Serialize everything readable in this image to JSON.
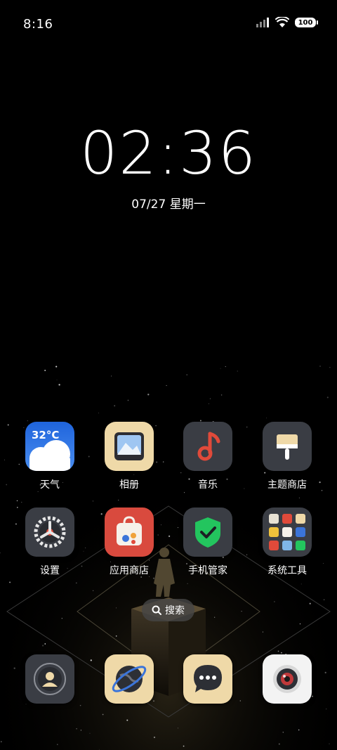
{
  "status_bar": {
    "time": "8:16",
    "battery": "100",
    "icons": [
      "signal-icon",
      "wifi-icon",
      "battery-icon"
    ]
  },
  "clock": {
    "time": "02:36",
    "date": "07/27 星期一"
  },
  "apps": {
    "weather": {
      "label": "天气",
      "temperature": "32°C"
    },
    "gallery": {
      "label": "相册"
    },
    "music": {
      "label": "音乐"
    },
    "theme_store": {
      "label": "主题商店"
    },
    "settings": {
      "label": "设置"
    },
    "app_store": {
      "label": "应用商店"
    },
    "phone_manager": {
      "label": "手机管家"
    },
    "system_tools": {
      "label": "系统工具"
    }
  },
  "search": {
    "label": "搜索"
  },
  "dock": [
    {
      "name": "contacts",
      "icon": "contacts-icon"
    },
    {
      "name": "browser",
      "icon": "browser-icon"
    },
    {
      "name": "messages",
      "icon": "messages-icon"
    },
    {
      "name": "camera",
      "icon": "camera-icon"
    }
  ],
  "colors": {
    "background": "#000000",
    "weather_blue": "#2f78e6",
    "cream": "#efd9a8",
    "dark_tile": "#3a3d44",
    "music_red": "#e04a3a",
    "shield_green": "#23c55e",
    "store_red": "#d94a3e"
  }
}
